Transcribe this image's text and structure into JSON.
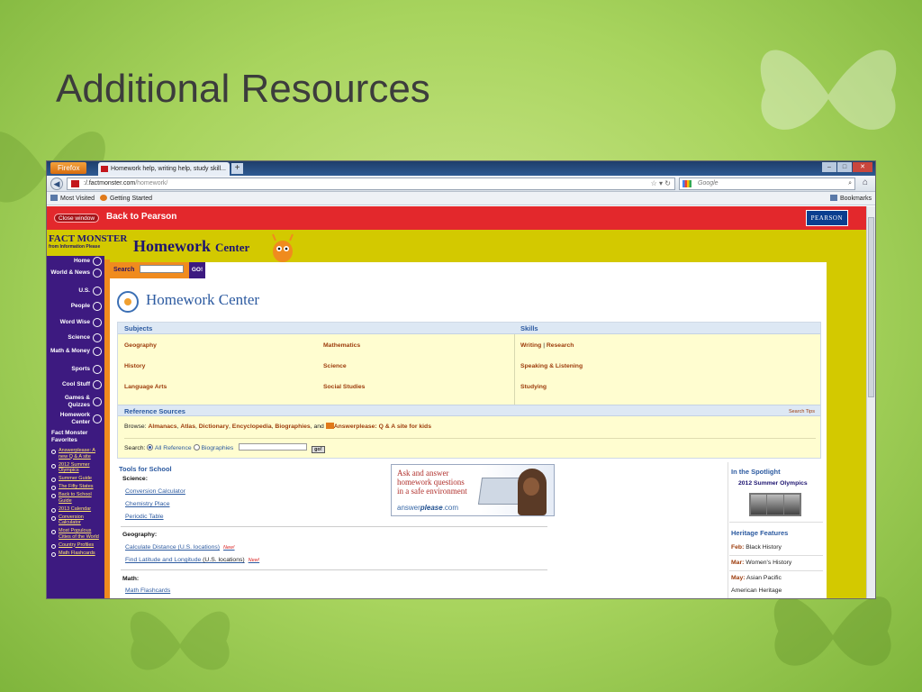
{
  "slide": {
    "title": "Additional Resources"
  },
  "browser": {
    "app_button": "Firefox",
    "tab_title": "Homework help, writing help, study skill...",
    "new_tab": "+",
    "url_host": ":/.factmonster.com",
    "url_path": "/homework/",
    "search_placeholder": "Google",
    "bookmarks": [
      "Most Visited",
      "Getting Started"
    ],
    "bookmarks_menu": "Bookmarks"
  },
  "topbar": {
    "close_window": "Close window",
    "back_link": "Back to Pearson",
    "brand": "PEARSON"
  },
  "site": {
    "logo": "FACT MONSTER",
    "logo_sub": "from Information Please",
    "banner": "Homework",
    "banner_center": "Center",
    "search_label": "Search",
    "search_go": "GO!",
    "page_title": "Homework Center"
  },
  "leftnav": {
    "items": [
      "Home",
      "World & News",
      "U.S.",
      "People",
      "Word Wise",
      "Science",
      "Math & Money",
      "Sports",
      "Cool Stuff",
      "Games & Quizzes",
      "Homework Center"
    ],
    "favorites_title": "Fact Monster Favorites",
    "favorites": [
      "Answerplease: A new Q & A site",
      "2012 Summer Olympics",
      "Summer Guide",
      "The Fifty States",
      "Back to School Guide",
      "2013 Calendar",
      "Conversion Calculator",
      "Most Populous Cities of the World",
      "Country Profiles",
      "Math Flashcards"
    ]
  },
  "subjects": {
    "heading": "Subjects",
    "col1": [
      "Geography",
      "History",
      "Language Arts"
    ],
    "col2": [
      "Mathematics",
      "Science",
      "Social Studies"
    ]
  },
  "skills": {
    "heading": "Skills",
    "row1a": "Writing",
    "sep": "|",
    "row1b": "Research",
    "row2": "Speaking & Listening",
    "row3": "Studying"
  },
  "reference": {
    "heading": "Reference Sources",
    "search_tips": "Search Tips",
    "browse_label": "Browse:",
    "links": [
      "Almanacs",
      "Atlas",
      "Dictionary",
      "Encyclopedia",
      "Biographies"
    ],
    "and": "and",
    "answerplease": "Answerplease: Q & A site for kids",
    "search_label": "Search:",
    "opt_all": "All Reference",
    "opt_bio": "Biographies",
    "go": "go!"
  },
  "tools": {
    "heading": "Tools for School",
    "science_label": "Science:",
    "science_links": [
      "Conversion Calculator",
      "Chemistry Place",
      "Periodic Table"
    ],
    "geography_label": "Geography:",
    "geo_link1": "Calculate Distance (U.S. locations)",
    "geo_link2": "Find Latitude and Longitude",
    "geo_link2_suffix": "(U.S. locations)",
    "new_badge": "New!",
    "math_label": "Math:",
    "math_link": "Math Flashcards"
  },
  "ad": {
    "line1": "Ask and answer",
    "line2": "homework questions",
    "line3": "in a safe environment",
    "brand_a": "answer",
    "brand_b": "please",
    "brand_c": ".com"
  },
  "spotlight": {
    "heading": "In the Spotlight",
    "olympics": "2012 Summer Olympics",
    "heritage_heading": "Heritage Features",
    "h1_month": "Feb:",
    "h1_text": "Black History",
    "h2_month": "Mar:",
    "h2_text": "Women's History",
    "h3_month": "May:",
    "h3_text": "Asian Pacific",
    "h3_text2": "American Heritage"
  },
  "colors": {
    "slide_bg": "#a4d05a",
    "site_yellow": "#d3c900",
    "nav_purple": "#3d1a80",
    "red_bar": "#e3282c",
    "link_brown": "#9c3b0b",
    "link_blue": "#2c5aa0"
  }
}
